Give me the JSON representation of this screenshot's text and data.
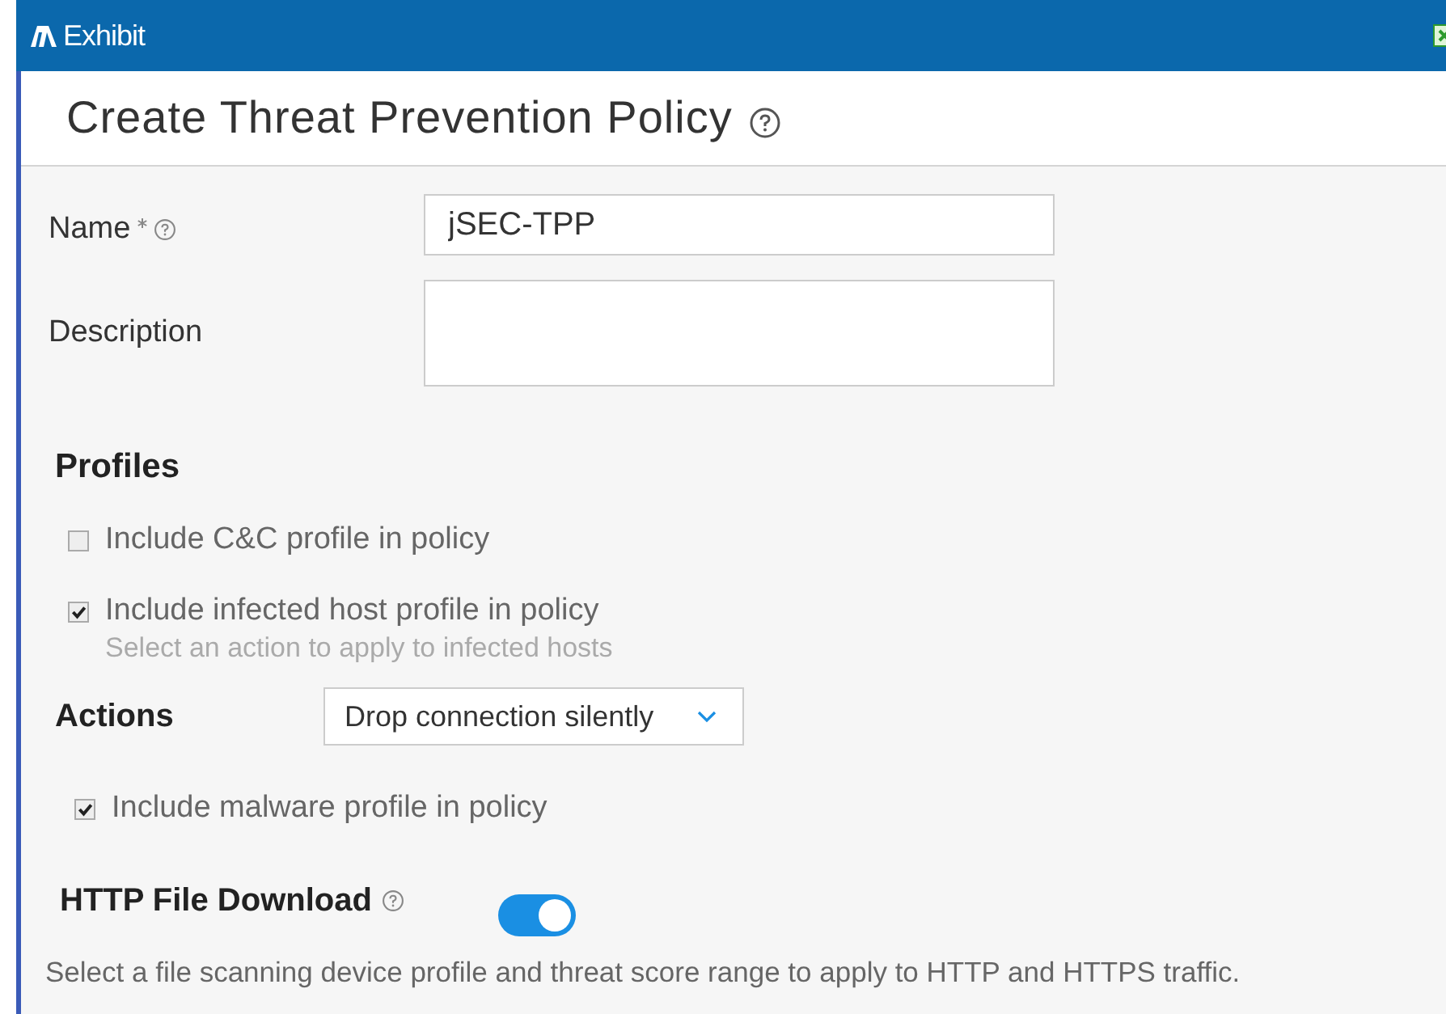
{
  "window": {
    "title": "Exhibit"
  },
  "dialog": {
    "title": "Create Threat Prevention Policy"
  },
  "fields": [
    {
      "kind": "input",
      "label": "Name",
      "required": true,
      "help": true,
      "value": "jSEC-TPP"
    },
    {
      "kind": "textarea",
      "label": "Description",
      "required": false,
      "help": false
    }
  ],
  "profiles": {
    "heading": "Profiles",
    "cc": {
      "label": "Include C&C profile in policy",
      "checked": false
    },
    "infected_host": {
      "label": "Include infected host profile in policy",
      "checked": true,
      "hint": "Select an action to apply to infected hosts"
    },
    "actions": {
      "label": "Actions",
      "value": "Drop connection silently"
    },
    "malware": {
      "label": "Include malware profile in policy",
      "checked": true
    },
    "http_download": {
      "label": "HTTP File Download",
      "on": true,
      "note": "Select a file scanning device profile and threat score range to apply to HTTP and HTTPS traffic."
    }
  }
}
